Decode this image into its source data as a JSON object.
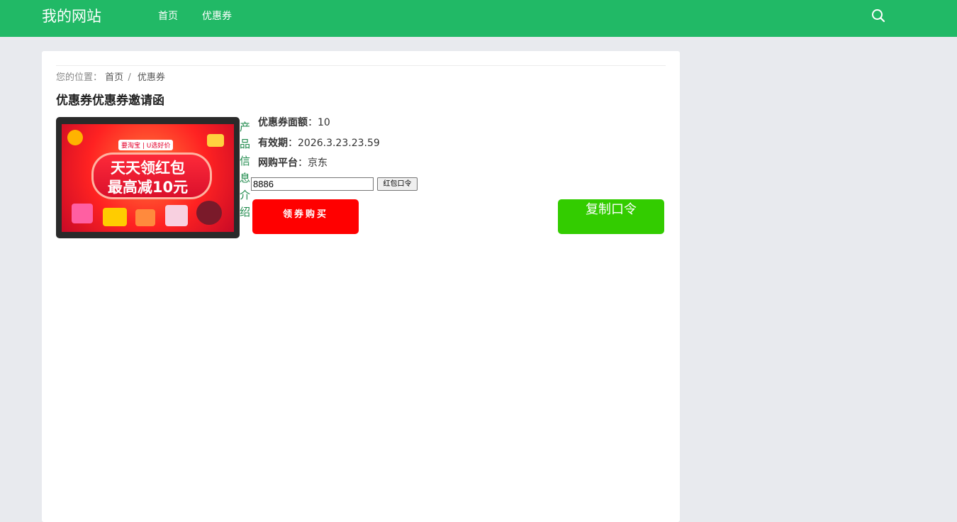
{
  "header": {
    "site_name": "我的网站",
    "nav": [
      "首页",
      "优惠券"
    ],
    "search_icon": "search-icon",
    "brand_color": "#21b966"
  },
  "breadcrumb": {
    "prefix": "您的位置：",
    "items": [
      "首页",
      "优惠券"
    ],
    "separator": "/"
  },
  "article": {
    "title": "优惠券优惠券邀请函",
    "image": {
      "tag": "要淘宝 | U选好价",
      "line1": "天天领红包",
      "line2": "最高减10元"
    },
    "vertical_text": "产品信息介绍"
  },
  "details": [
    {
      "label": "优惠券面额",
      "value": "10"
    },
    {
      "label": "有效期",
      "value": "2026.3.23.23.59"
    },
    {
      "label": "网购平台",
      "value": "京东"
    }
  ],
  "code_input": {
    "value": "8886"
  },
  "code_button": "红包口令",
  "buy_button": "领券购买",
  "copy_button": "复制口令",
  "colors": {
    "buy_button": "#ff0000",
    "copy_button": "#33cc00",
    "page_background": "#e8eaee"
  }
}
